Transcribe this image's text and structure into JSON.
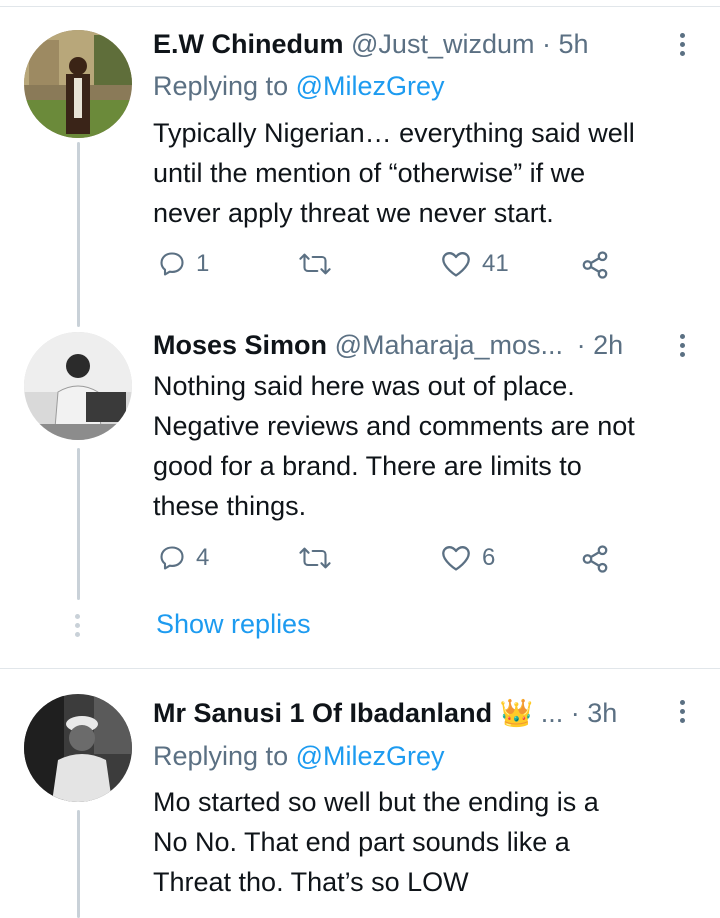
{
  "tweets": [
    {
      "name": "E.W Chinedum",
      "handle": "@Just_wizdum",
      "separator": "·",
      "time": "5h",
      "replying_prefix": "Replying to",
      "replying_to": "@MilezGrey",
      "text": [
        "Typically Nigerian… everything said well",
        "until the mention of “otherwise” if we",
        "never apply threat we never start."
      ],
      "replies": "1",
      "retweets": "",
      "likes": "41"
    },
    {
      "name": "Moses Simon",
      "handle": "@Maharaja_mos...",
      "separator": "·",
      "time": "2h",
      "text": [
        "Nothing said here was out of place.",
        "Negative reviews and comments are not",
        "good for a brand. There are limits to",
        "these things."
      ],
      "replies": "4",
      "retweets": "",
      "likes": "6"
    },
    {
      "name": "Mr Sanusi 1 Of Ibadanland",
      "emoji": "👑",
      "ellipsis": "...",
      "separator": "·",
      "time": "3h",
      "replying_prefix": "Replying to",
      "replying_to": "@MilezGrey",
      "text": [
        "Mo started so well but the ending is a",
        "No No. That end part sounds like a",
        "Threat tho. That’s so LOW"
      ]
    }
  ],
  "show_replies_label": "Show replies",
  "icons": {
    "reply": "reply-icon",
    "retweet": "retweet-icon",
    "like": "heart-icon",
    "share": "share-icon",
    "more": "more-vertical-icon"
  },
  "colors": {
    "accent": "#1d9bf0",
    "secondary_text": "#5b7083",
    "primary_text": "#0f1419",
    "thread_line": "#c9d1d8"
  }
}
